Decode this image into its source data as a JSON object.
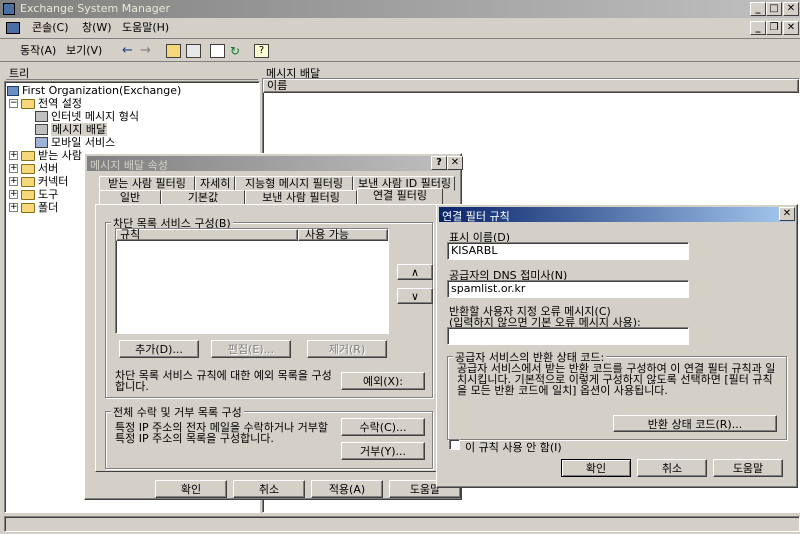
{
  "app": {
    "title": "Exchange System Manager",
    "menu": [
      "콘솔(C)",
      "창(W)",
      "도움말(H)"
    ],
    "toolbar": {
      "action": "동작(A)",
      "view": "보기(V)"
    }
  },
  "left_pane": {
    "header": "트리",
    "tree": [
      {
        "label": "First Organization(Exchange)"
      },
      {
        "label": "전역 설정"
      },
      {
        "label": "인터넷 메시지 형식"
      },
      {
        "label": "메시지 배달"
      },
      {
        "label": "모바일 서비스"
      },
      {
        "label": "받는 사람"
      },
      {
        "label": "서버"
      },
      {
        "label": "커넥터"
      },
      {
        "label": "도구"
      },
      {
        "label": "폴더"
      }
    ]
  },
  "right_pane": {
    "header": "메시지 배달",
    "column": "이름"
  },
  "props_dialog": {
    "title": "메시지 배달 속성",
    "help": "?",
    "close": "✕",
    "tabs_row1": [
      "받는 사람 필터링",
      "자세히",
      "지능형 메시지 필터링",
      "보낸 사람 ID 필터링"
    ],
    "tabs_row2": [
      "일반",
      "기본값",
      "보낸 사람 필터링",
      "연결 필터링"
    ],
    "block_group": "차단 목록 서비스 구성(B)",
    "list_columns": [
      "규칙",
      "사용 가능"
    ],
    "up": "∧",
    "down": "∨",
    "add": "추가(D)...",
    "edit": "편집(E)...",
    "remove": "제거(R)",
    "exception_text": "차단 목록 서비스 규칙에 대한 예외 목록을 구성합니다.",
    "exception_btn": "예외(X):",
    "global_group": "전체 수락 및 거부 목록 구성",
    "global_text": "특정 IP 주소의 전자 메일을 수락하거나 거부할 특정 IP 주소의 목록을 구성합니다.",
    "accept_btn": "수락(C)...",
    "deny_btn": "거부(Y)...",
    "ok": "확인",
    "cancel": "취소",
    "apply": "적용(A)",
    "help_btn": "도움말"
  },
  "rule_dialog": {
    "title": "연결 필터 규칙",
    "close": "✕",
    "display_name_label": "표시 이름(D)",
    "display_name_value": "KISARBL",
    "dns_label": "공급자의 DNS 접미사(N)",
    "dns_value": "spamlist.or.kr",
    "error_label": "반환할 사용자 지정 오류 메시지(C)",
    "error_hint": "(입력하지 않으면 기본 오류 메시지 사용):",
    "error_value": "",
    "status_group": "공급자 서비스의 반환 상태 코드:",
    "status_text": "공급자 서비스에서 받는 반환 코드를 구성하여 이 연결 필터 규칙과 일치시킵니다. 기본적으로 이렇게 구성하지 않도록 선택하면 [필터 규칙을 모든 반환 코드에 일치] 옵션이 사용됩니다.",
    "status_btn": "반환 상태 코드(R)...",
    "disable_label": "이 규칙 사용 안 함(I)",
    "ok": "확인",
    "cancel": "취소",
    "help": "도움말"
  }
}
